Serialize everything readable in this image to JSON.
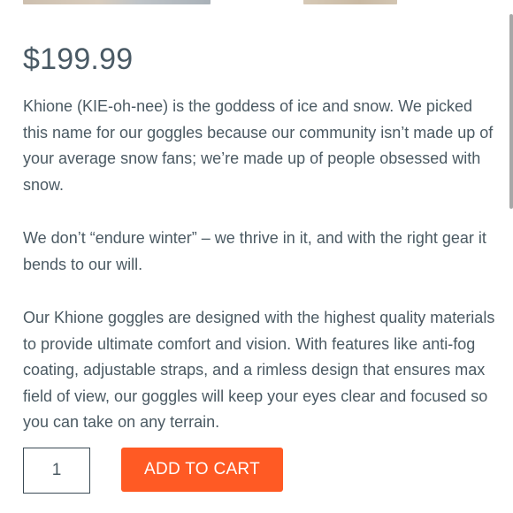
{
  "product": {
    "price": "$199.99",
    "description": [
      "Khione (KIE-oh-nee) is the goddess of ice and snow. We picked this name for our goggles because our community isn’t made up of your average snow fans; we’re made up of people obsessed with snow.",
      "We don’t “endure winter” – we thrive in it, and with the right gear it bends to our will.",
      "Our Khione goggles are designed with the highest quality materials to provide ultimate comfort and vision. With features like anti-fog coating, adjustable straps, and a rimless design that ensures max field of view, our goggles will keep your eyes clear and focused so you can take on any terrain."
    ]
  },
  "cart": {
    "quantity": "1",
    "add_label": "ADD TO CART"
  },
  "colors": {
    "accent": "#ff5a24",
    "text": "#4b5a63"
  }
}
